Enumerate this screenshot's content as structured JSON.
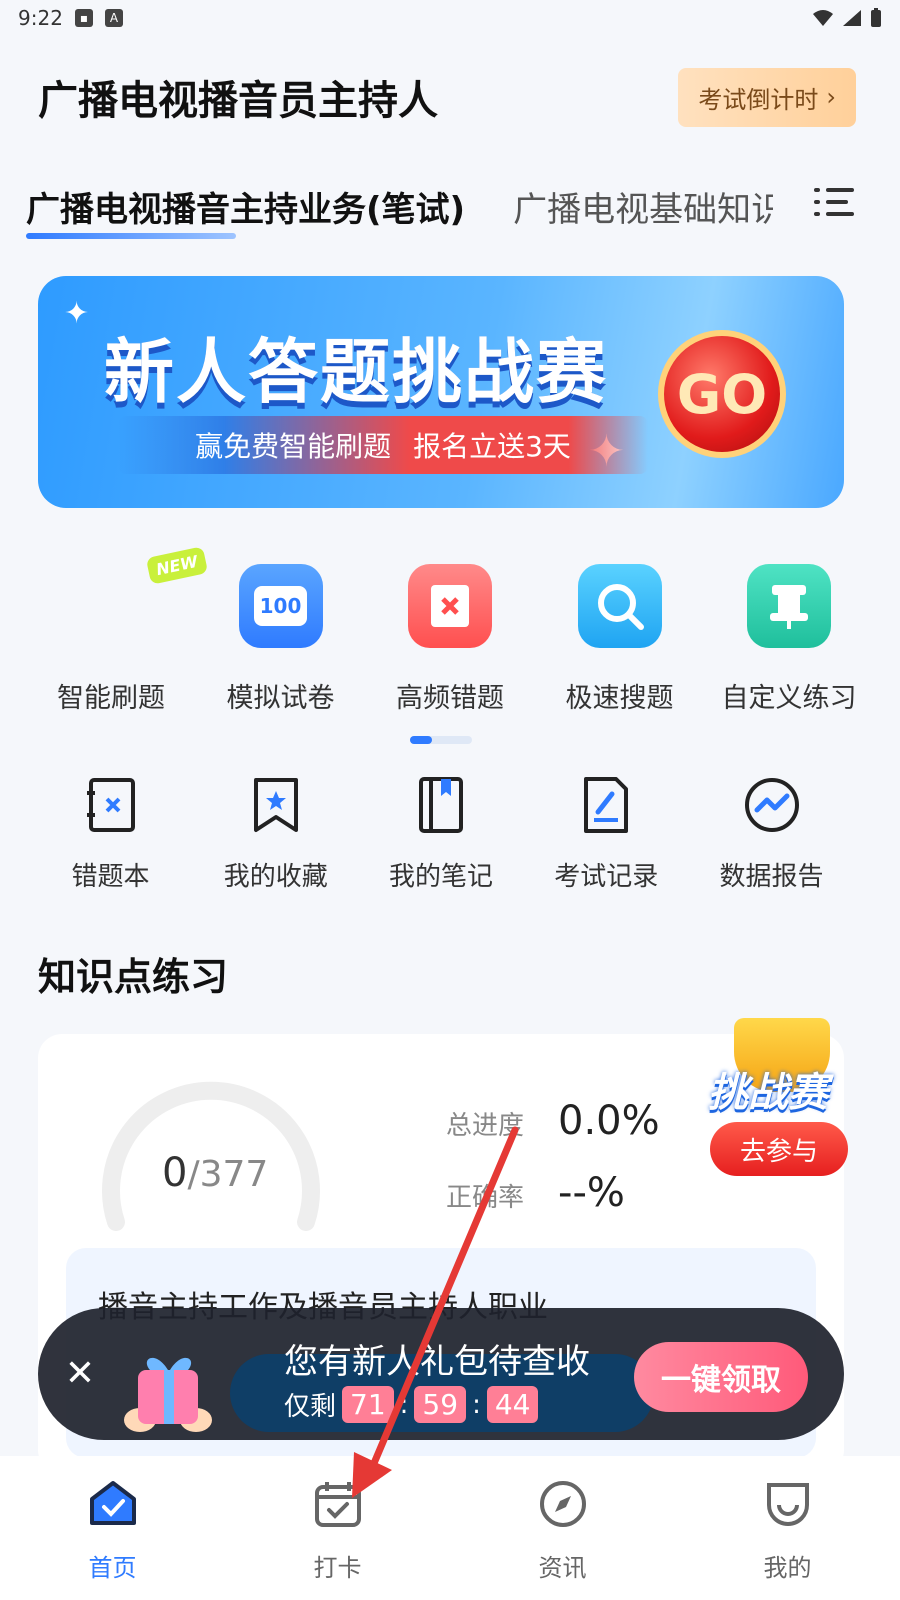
{
  "status_bar": {
    "time": "9:22"
  },
  "header": {
    "title": "广播电视播音员主持人",
    "countdown_label": "考试倒计时"
  },
  "tabs": [
    {
      "label": "广播电视播音主持业务(笔试)",
      "active": true
    },
    {
      "label": "广播电视基础知识",
      "active": false
    }
  ],
  "banner": {
    "headline": "新人答题挑战赛",
    "sub_left": "赢免费智能刷题",
    "sub_right": "报名立送3天",
    "go_label": "GO"
  },
  "quick_actions": {
    "new_badge": "NEW",
    "items": [
      {
        "label": "智能刷题",
        "icon": "smart-practice-icon",
        "color": "#3a8dff"
      },
      {
        "label": "模拟试卷",
        "icon": "mock-exam-icon",
        "color": "#2f7bff",
        "glyph": "100"
      },
      {
        "label": "高频错题",
        "icon": "frequent-errors-icon",
        "color": "#ff5a5a"
      },
      {
        "label": "极速搜题",
        "icon": "quick-search-icon",
        "color": "#25b6f5"
      },
      {
        "label": "自定义练习",
        "icon": "custom-practice-icon",
        "color": "#2ad1b0"
      }
    ]
  },
  "tools": [
    {
      "label": "错题本",
      "icon": "error-book-icon"
    },
    {
      "label": "我的收藏",
      "icon": "bookmark-icon"
    },
    {
      "label": "我的笔记",
      "icon": "notebook-icon"
    },
    {
      "label": "考试记录",
      "icon": "exam-record-icon"
    },
    {
      "label": "数据报告",
      "icon": "data-report-icon"
    }
  ],
  "knowledge": {
    "section_title": "知识点练习",
    "done": "0",
    "total": "/377",
    "progress_label": "总进度",
    "progress_value": "0.0%",
    "accuracy_label": "正确率",
    "accuracy_value": "--%",
    "chapter_title": "播音主持工作及播音员主持人职业"
  },
  "challenge": {
    "title": "挑战赛",
    "join_label": "去参与"
  },
  "gift_toast": {
    "message": "您有新人礼包待查收",
    "remaining_label": "仅剩",
    "hours": "71",
    "minutes": "59",
    "seconds": "44",
    "separator": ":",
    "claim_label": "一键领取"
  },
  "bottom_nav": [
    {
      "label": "首页",
      "icon": "home-icon",
      "active": true
    },
    {
      "label": "打卡",
      "icon": "check-in-calendar-icon",
      "active": false
    },
    {
      "label": "资讯",
      "icon": "compass-icon",
      "active": false
    },
    {
      "label": "我的",
      "icon": "profile-icon",
      "active": false
    }
  ],
  "colors": {
    "accent": "#2f7bff",
    "annotation_arrow": "#e53935"
  }
}
